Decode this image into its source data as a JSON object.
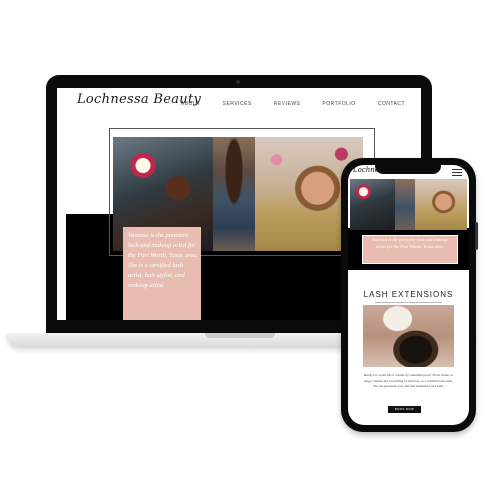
{
  "site": {
    "logo": "Lochnessa Beauty",
    "nav": [
      "ABOUT",
      "SERVICES",
      "REVIEWS",
      "PORTFOLIO",
      "CONTACT"
    ]
  },
  "hero": {
    "intro": "Vanessa is the premiere lash and makeup artist for the Fort Worth, Texas area. She is a certified lash artist, hair stylist, and makeup artist."
  },
  "mobile": {
    "logo": "Lochnessa",
    "intro": "Vanessa is the premiere lash and makeup artist for the Fort Worth, Texas area.",
    "section_title": "LASH EXTENSIONS",
    "body": "Ready for a lash lift or wanna try something new? From classic to mega volume and everything in-between, as a certified lash artist, she can guarantee you will feel beautiful every time.",
    "button": "BOOK NOW"
  },
  "colors": {
    "accent_pink": "#e8bcb0",
    "dark": "#0b0b0b"
  },
  "icons": [
    "menu-icon"
  ]
}
